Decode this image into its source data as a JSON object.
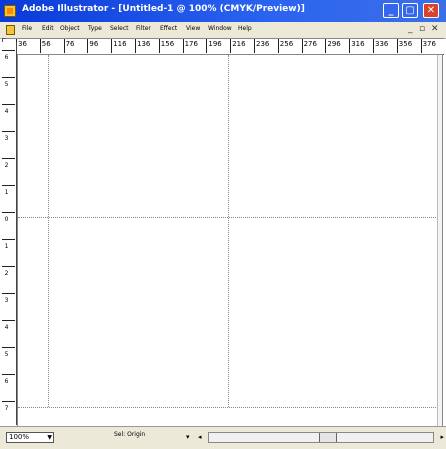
{
  "window": {
    "title": "Adobe Illustrator - [Untitled-1 @ 100% (CMYK/Preview)]",
    "buttons": [
      "minimize",
      "maximize",
      "close"
    ]
  },
  "menubar": {
    "items": [
      "File",
      "Edit",
      "Object",
      "Type",
      "Select",
      "Filter",
      "Effect",
      "View",
      "Window",
      "Help"
    ],
    "mdi": [
      "_",
      "▫",
      "✕"
    ]
  },
  "hruler": {
    "labels": [
      "36",
      "56",
      "76",
      "96",
      "116",
      "136",
      "156",
      "176",
      "196",
      "216",
      "236",
      "256",
      "276",
      "296",
      "316",
      "336",
      "356",
      "376"
    ]
  },
  "vruler": {
    "labels": [
      "6",
      "5",
      "4",
      "3",
      "2",
      "1",
      "0",
      "1",
      "2",
      "3",
      "4",
      "5",
      "6",
      "7"
    ]
  },
  "status": {
    "zoom": "100%",
    "message": "Sel: Origin"
  },
  "colors": {
    "titlebar": "#0a3ad8",
    "chrome": "#ece9d8",
    "canvas": "#ffffff"
  }
}
